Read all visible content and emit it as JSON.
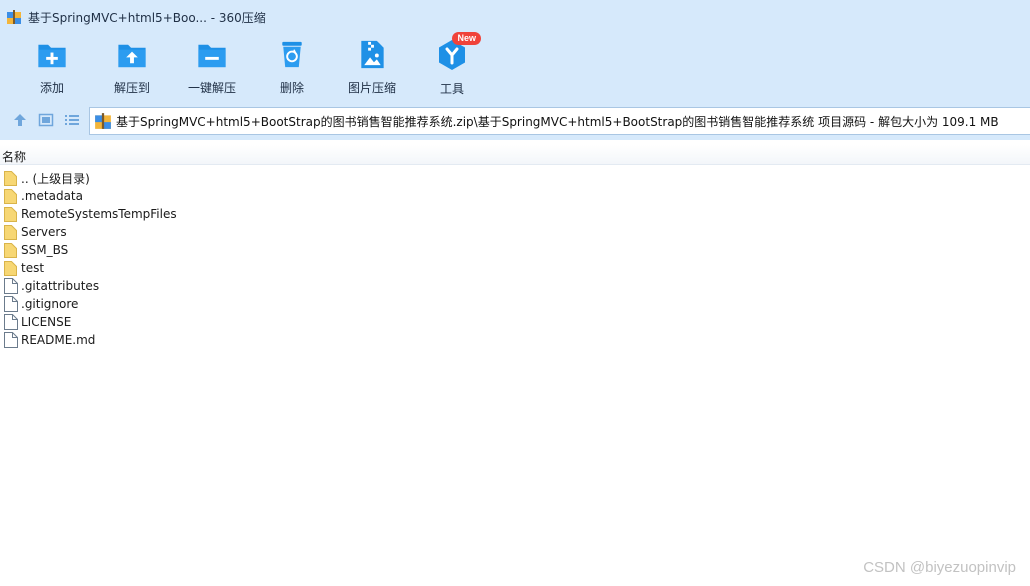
{
  "window": {
    "title": "基于SpringMVC+html5+Boo...",
    "separator": "-",
    "app_name": "360压缩"
  },
  "toolbar": {
    "items": [
      {
        "label": "添加",
        "icon": "add-icon"
      },
      {
        "label": "解压到",
        "icon": "extract-to-icon"
      },
      {
        "label": "一键解压",
        "icon": "one-click-extract-icon"
      },
      {
        "label": "删除",
        "icon": "delete-icon"
      },
      {
        "label": "图片压缩",
        "icon": "image-compress-icon"
      },
      {
        "label": "工具",
        "icon": "tools-icon",
        "badge": "New"
      }
    ]
  },
  "address": {
    "path": "基于SpringMVC+html5+BootStrap的图书销售智能推荐系统.zip\\基于SpringMVC+html5+BootStrap的图书销售智能推荐系统 项目源码 - 解包大小为 109.1 MB"
  },
  "filelist": {
    "column_name": "名称",
    "items": [
      {
        "name": ".. (上级目录)",
        "type": "folder"
      },
      {
        "name": ".metadata",
        "type": "folder"
      },
      {
        "name": "RemoteSystemsTempFiles",
        "type": "folder"
      },
      {
        "name": "Servers",
        "type": "folder"
      },
      {
        "name": "SSM_BS",
        "type": "folder"
      },
      {
        "name": "test",
        "type": "folder"
      },
      {
        "name": ".gitattributes",
        "type": "file"
      },
      {
        "name": ".gitignore",
        "type": "file"
      },
      {
        "name": "LICENSE",
        "type": "file"
      },
      {
        "name": "README.md",
        "type": "file"
      }
    ]
  },
  "watermark": "CSDN @biyezuopinvip",
  "colors": {
    "toolbar_bg": "#d6e9fb",
    "icon_blue": "#1e90e6",
    "folder_yellow": "#f7d774",
    "badge_red": "#f0433a"
  }
}
